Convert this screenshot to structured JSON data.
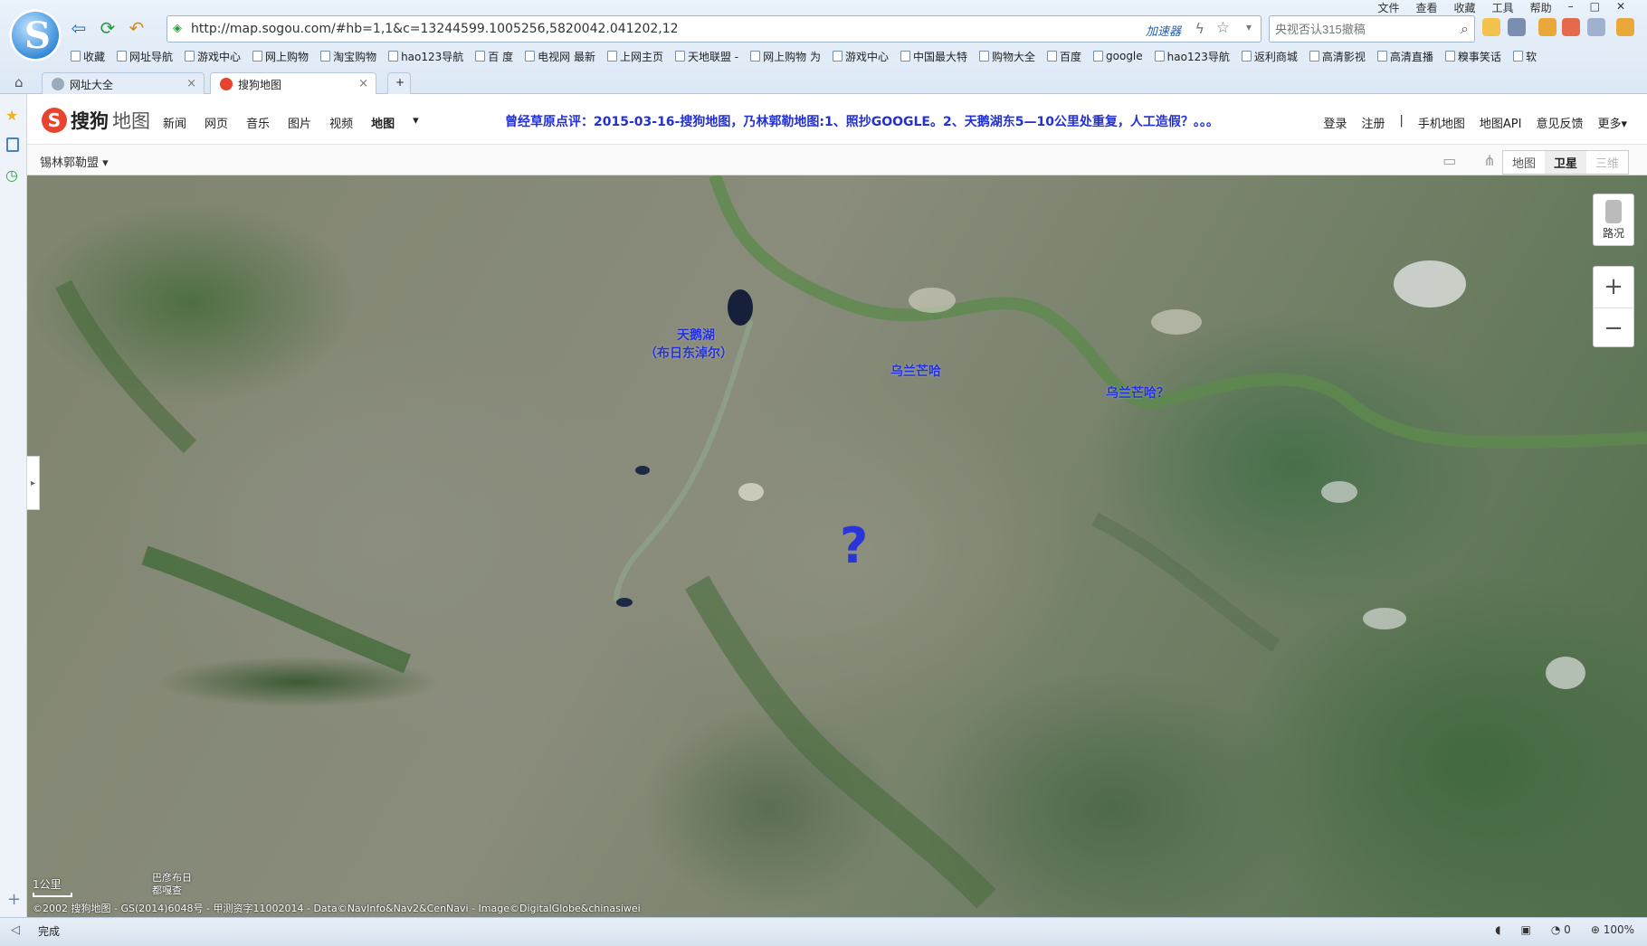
{
  "browser": {
    "menu": [
      "文件",
      "查看",
      "收藏",
      "工具",
      "帮助"
    ],
    "url": "http://map.sogou.com/#hb=1,1&c=13244599.1005256,5820042.041202,12",
    "accelerator": "加速器",
    "search_placeholder": "央视否认315撤稿",
    "bookmarks": [
      "收藏",
      "网址导航",
      "游戏中心",
      "网上购物",
      "淘宝购物",
      "hao123导航",
      "百 度",
      "电视网 最新",
      "上网主页",
      "天地联盟 -",
      "网上购物 为",
      "游戏中心",
      "中国最大特",
      "购物大全",
      "百度",
      "google",
      "hao123导航",
      "返利商城",
      "高清影视",
      "高清直播",
      "糗事笑话",
      "软"
    ],
    "tabs": [
      {
        "label": "网址大全",
        "active": false
      },
      {
        "label": "搜狗地图",
        "active": true
      }
    ],
    "new_tab": "+",
    "status": "完成",
    "status_right": [
      "0",
      "100%"
    ]
  },
  "site": {
    "logo_badge": "S",
    "logo_text": "搜狗",
    "logo_text2": "地图",
    "nav": [
      "新闻",
      "网页",
      "音乐",
      "图片",
      "视频",
      "地图"
    ],
    "current_nav": "地图",
    "comment": "曾经草原点评：2015-03-16-搜狗地图，乃林郭勒地图:1、照抄GOOGLE。2、天鹅湖东5—10公里处重复，人工造假？。。。",
    "right_links": [
      "登录",
      "注册",
      "|",
      "手机地图",
      "地图API",
      "意见反馈",
      "更多▾"
    ]
  },
  "toolbar": {
    "city": "锡林郭勒盟",
    "view_options": [
      "地图",
      "卫星",
      "三维"
    ],
    "view_selected": "卫星"
  },
  "map": {
    "labels": {
      "lake": "天鹅湖",
      "lake_alt": "（布日东淖尔）",
      "place1": "乌兰芒哈",
      "place2": "乌兰芒哈？",
      "question": "?"
    },
    "traffic": "路况",
    "zoom_in": "+",
    "zoom_out": "−",
    "scale": "1公里",
    "placename_line1": "巴彦布日",
    "placename_line2": "都嘎查",
    "copyright": "©2002 搜狗地图 - GS(2014)6048号 - 甲测资字11002014 - Data©NavInfo&Nav2&CenNavi - Image©DigitalGlobe&chinasiwei"
  },
  "colors": {
    "accent": "#e8432e",
    "label": "#2230e0",
    "link": "#1a5fb4"
  }
}
